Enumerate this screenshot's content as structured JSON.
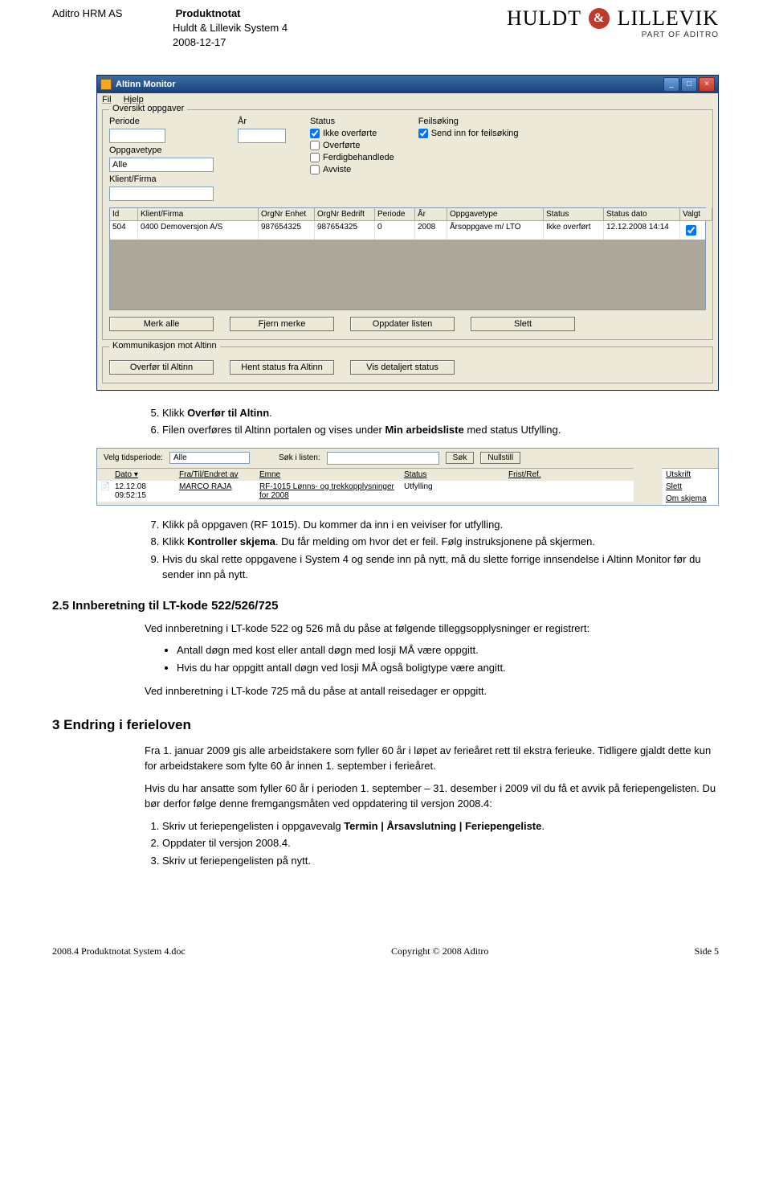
{
  "header": {
    "company": "Aditro HRM AS",
    "title": "Produktnotat",
    "subtitle": "Huldt & Lillevik System 4",
    "date": "2008-12-17"
  },
  "logo": {
    "left": "HULDT",
    "amp": "&",
    "right": "LILLEVIK",
    "sub": "PART OF ADITRO"
  },
  "app": {
    "title": "Altinn Monitor",
    "menu": {
      "file": "Fil",
      "help": "Hjelp"
    },
    "group1": "Oversikt oppgaver",
    "labels": {
      "periode": "Periode",
      "ar": "År",
      "status": "Status",
      "feilsoking": "Feilsøking",
      "oppgavetype": "Oppgavetype",
      "klientfirma": "Klient/Firma"
    },
    "values": {
      "oppgavetype": "Alle"
    },
    "status_opts": {
      "ikke": "Ikke overførte",
      "over": "Overførte",
      "ferdig": "Ferdigbehandlede",
      "avviste": "Avviste"
    },
    "feilsok_opt": "Send inn for feilsøking",
    "cols": {
      "id": "Id",
      "klient": "Klient/Firma",
      "orgenhet": "OrgNr Enhet",
      "orgbedrift": "OrgNr Bedrift",
      "periode": "Periode",
      "ar": "År",
      "oppgavetype": "Oppgavetype",
      "status": "Status",
      "statusdato": "Status dato",
      "valgt": "Valgt"
    },
    "row": {
      "id": "504",
      "klient": "0400 Demoversjon A/S",
      "orgenhet": "987654325",
      "orgbedrift": "987654325",
      "periode": "0",
      "ar": "2008",
      "oppgavetype": "Årsoppgave m/ LTO",
      "status": "Ikke overført",
      "statusdato": "12.12.2008 14:14"
    },
    "buttons1": {
      "merk": "Merk alle",
      "fjern": "Fjern merke",
      "oppdater": "Oppdater listen",
      "slett": "Slett"
    },
    "group2": "Kommunikasjon mot Altinn",
    "buttons2": {
      "overfor": "Overfør til Altinn",
      "hent": "Hent status fra Altinn",
      "vis": "Vis detaljert status"
    }
  },
  "steps_a": {
    "s5_pre": "Klikk ",
    "s5_bold": "Overfør til Altinn",
    "s5_post": ".",
    "s6_pre": "Filen overføres til Altinn portalen og vises under ",
    "s6_bold": "Min arbeidsliste",
    "s6_post": " med status Utfylling."
  },
  "mini": {
    "velg": "Velg tidsperiode:",
    "alle": "Alle",
    "sok_label": "Søk i listen:",
    "sok_btn": "Søk",
    "null_btn": "Nullstill",
    "cols": {
      "dato": "Dato ▾",
      "fra": "Fra/Til/Endret av",
      "emne": "Emne",
      "status": "Status",
      "frist": "Frist/Ref."
    },
    "row": {
      "dato": "12.12.08 09:52:15",
      "fra": "MARCO RAJA",
      "emne": "RF-1015 Lønns- og trekkopplysninger for 2008",
      "status": "Utfylling"
    },
    "side": {
      "utskrift": "Utskrift",
      "slett": "Slett",
      "om": "Om skjema"
    }
  },
  "steps_b": {
    "s7": "Klikk på oppgaven (RF 1015). Du kommer da inn i en veiviser for utfylling.",
    "s8_pre": "Klikk ",
    "s8_bold": "Kontroller skjema",
    "s8_post": ". Du får melding om hvor det er feil. Følg instruksjonene på skjermen.",
    "s9": "Hvis du skal rette oppgavene i System 4 og sende inn på nytt, må du slette forrige innsendelse i Altinn Monitor før du sender inn på nytt."
  },
  "sec25": {
    "title": "2.5 Innberetning til LT-kode 522/526/725",
    "p1": "Ved innberetning i LT-kode 522 og 526 må du påse at følgende tilleggsopplysninger er registrert:",
    "b1": "Antall døgn med kost eller antall døgn med losji MÅ være oppgitt.",
    "b2": "Hvis du har oppgitt antall døgn ved losji MÅ også boligtype være angitt.",
    "p2": "Ved innberetning i LT-kode 725 må du påse at antall reisedager er oppgitt."
  },
  "sec3": {
    "title": "3 Endring i ferieloven",
    "p1": "Fra 1. januar 2009 gis alle arbeidstakere som fyller 60 år i løpet av ferieåret rett til ekstra ferieuke. Tidligere gjaldt dette kun for arbeidstakere som fylte 60 år innen 1. september i ferieåret.",
    "p2": "Hvis du har ansatte som fyller 60 år i perioden 1. september – 31. desember i 2009 vil du få et avvik på feriepengelisten. Du bør derfor følge denne fremgangsmåten ved oppdatering til versjon 2008.4:",
    "l1_pre": "Skriv ut feriepengelisten i oppgavevalg ",
    "l1_bold": "Termin | Årsavslutning | Feriepengeliste",
    "l1_post": ".",
    "l2": "Oppdater til versjon 2008.4.",
    "l3": "Skriv ut feriepengelisten på nytt."
  },
  "footer": {
    "left": "2008.4 Produktnotat System 4.doc",
    "center": "Copyright © 2008 Aditro",
    "right": "Side 5"
  }
}
